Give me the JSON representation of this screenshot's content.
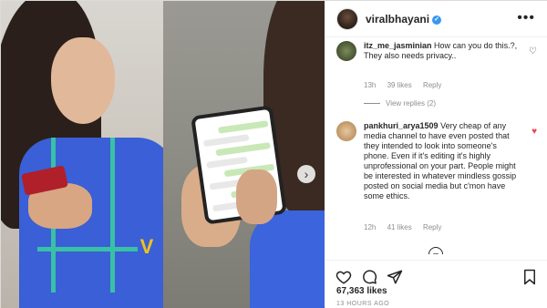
{
  "header": {
    "username": "viralbhayani",
    "verified_mark": "✓",
    "more_icon": "more-horizontal-icon"
  },
  "media": {
    "watermark": "V",
    "next_arrow": "›"
  },
  "comments": [
    {
      "username": "itz_me_jasminian",
      "text": "How can you do this.?, They also needs privacy..",
      "time": "13h",
      "likes": "39 likes",
      "reply": "Reply",
      "liked": false
    },
    {
      "username": "pankhuri_arya1509",
      "text": "Very cheap of any media channel to have even posted that they intended to look into someone's phone. Even if it's editing it's highly unprofessional on your part. People might be interested in whatever mindless gossip posted on social media but c'mon have some ethics.",
      "time": "12h",
      "likes": "41 likes",
      "reply": "Reply",
      "liked": true
    }
  ],
  "view_replies": "View replies (2)",
  "load_more_icon": "plus-circle-icon",
  "actions": {
    "like_icon": "heart-icon",
    "comment_icon": "comment-icon",
    "share_icon": "share-icon",
    "save_icon": "bookmark-icon"
  },
  "likes_count": "67,363 likes",
  "timestamp": "13 HOURS AGO",
  "colors": {
    "verified": "#3897f0",
    "liked_heart": "#ed4956",
    "meta_gray": "#8e8e8e"
  }
}
